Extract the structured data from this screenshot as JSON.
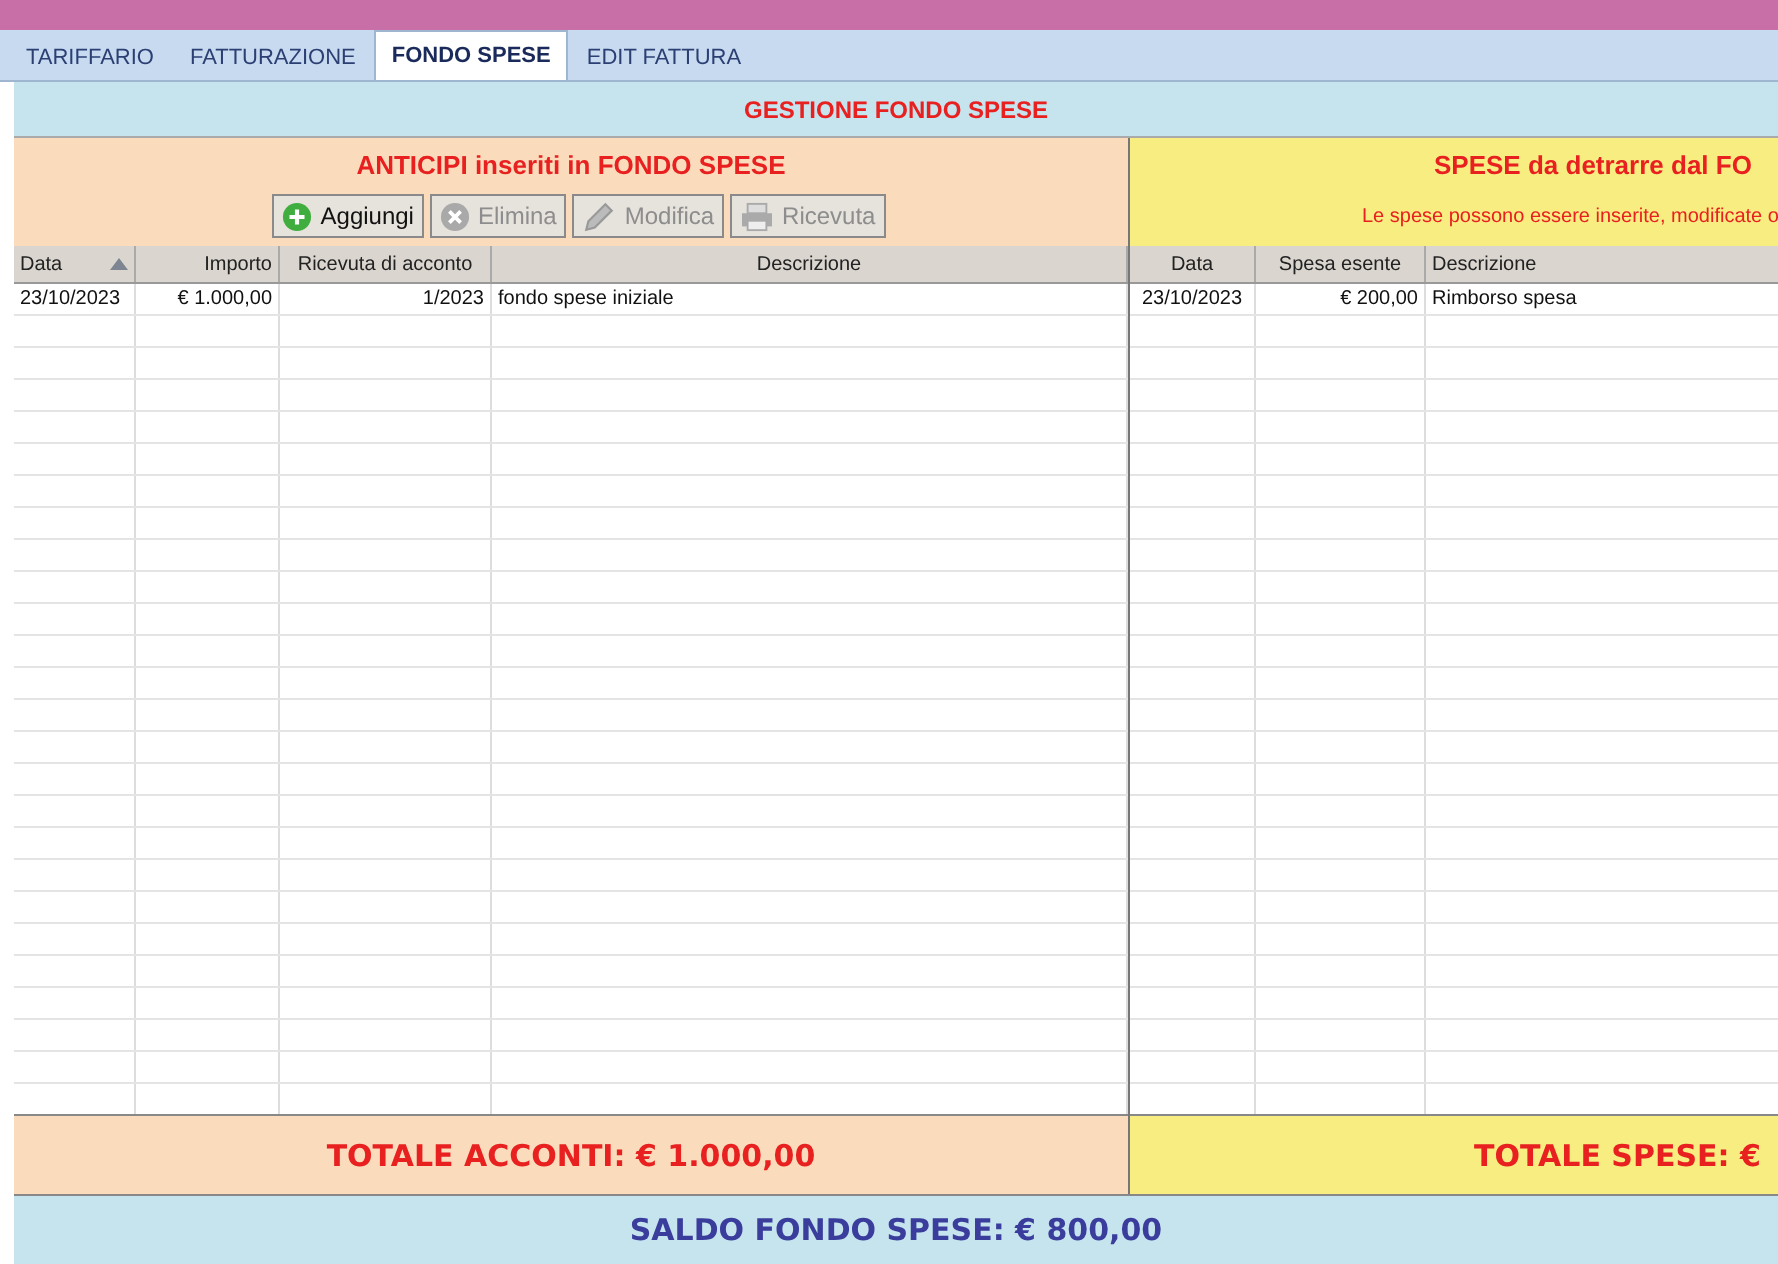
{
  "tabs": [
    {
      "label": "TARIFFARIO",
      "selected": false
    },
    {
      "label": "FATTURAZIONE",
      "selected": false
    },
    {
      "label": "FONDO SPESE",
      "selected": true
    },
    {
      "label": "EDIT FATTURA",
      "selected": false
    }
  ],
  "header": "GESTIONE FONDO SPESE",
  "left_panel": {
    "title": "ANTICIPI inseriti in FONDO SPESE",
    "buttons": [
      {
        "label": "Aggiungi",
        "kind": "add",
        "disabled": false
      },
      {
        "label": "Elimina",
        "kind": "delete",
        "disabled": true
      },
      {
        "label": "Modifica",
        "kind": "edit",
        "disabled": true
      },
      {
        "label": "Ricevuta",
        "kind": "print",
        "disabled": true
      }
    ],
    "columns": [
      {
        "label": "Data",
        "sorted": true
      },
      {
        "label": "Importo",
        "sorted": false
      },
      {
        "label": "Ricevuta di acconto",
        "sorted": false
      },
      {
        "label": "Descrizione",
        "sorted": false
      }
    ],
    "rows": [
      [
        "23/10/2023",
        "€ 1.000,00",
        "1/2023",
        "fondo spese iniziale"
      ]
    ],
    "total": "TOTALE ACCONTI: € 1.000,00"
  },
  "right_panel": {
    "title": "SPESE da detrarre dal FO",
    "note": "Le spese possono essere inserite, modificate o",
    "columns": [
      {
        "label": "Data",
        "sorted": false
      },
      {
        "label": "Spesa esente",
        "sorted": false
      },
      {
        "label": "Descrizione",
        "sorted": false
      }
    ],
    "rows": [
      [
        "23/10/2023",
        "€ 200,00",
        "Rimborso spesa"
      ]
    ],
    "total": "TOTALE SPESE: €"
  },
  "balance": "SALDO FONDO SPESE: € 800,00"
}
